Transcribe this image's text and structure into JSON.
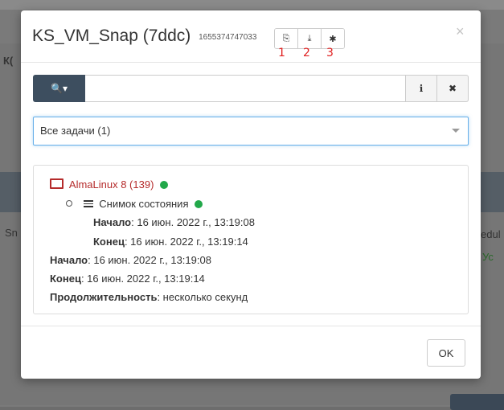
{
  "modal": {
    "title": "KS_VM_Snap (7ddc)",
    "title_id": "1655374747033",
    "header_buttons": [
      {
        "icon": "copy-icon",
        "glyph": "⎘",
        "marker": "1"
      },
      {
        "icon": "download-icon",
        "glyph": "⤓",
        "marker": "2"
      },
      {
        "icon": "bug-icon",
        "glyph": "✱",
        "marker": "3"
      }
    ],
    "close_glyph": "×"
  },
  "search": {
    "button_glyph": "🔍▾",
    "value": "",
    "info_glyph": "ℹ",
    "clear_glyph": "✖"
  },
  "filter": {
    "selected": "Все задачи (1)"
  },
  "tasks": {
    "vm_name": "AlmaLinux 8 (139)",
    "subtask": "Снимок состояния",
    "sub_start_label": "Начало",
    "sub_start_value": ": 16 июн. 2022 г., 13:19:08",
    "sub_end_label": "Конец",
    "sub_end_value": ": 16 июн. 2022 г., 13:19:14",
    "start_label": "Начало",
    "start_value": ": 16 июн. 2022 г., 13:19:08",
    "end_label": "Конец",
    "end_value": ": 16 июн. 2022 г., 13:19:14",
    "duration_label": "Продолжительность",
    "duration_value": ": несколько секунд",
    "status_color": "#22a84a"
  },
  "footer": {
    "ok_label": "OK"
  },
  "background": {
    "left_fragment_top": "К(",
    "left_fragment_mid": "Sn",
    "right_fragment_mid": "edul",
    "right_fragment_low": "Ус"
  }
}
